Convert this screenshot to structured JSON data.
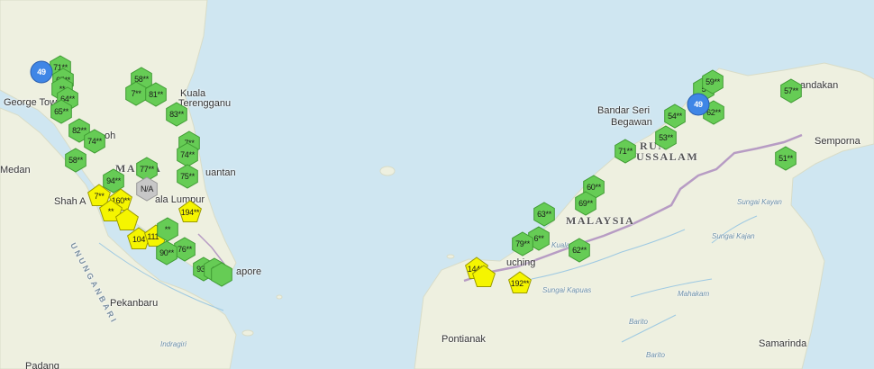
{
  "colors": {
    "sea": "#cfe6f1",
    "land": "#eef0e0",
    "good": "#66cc55",
    "moderate": "#f5f500",
    "blue": "#3f86e6",
    "na": "#c7c7c7",
    "border": "#b79cc4",
    "river": "#9ec9e2"
  },
  "labels": [
    {
      "id": "kuala-terengganu-1",
      "text": "Kuala",
      "kind": "city"
    },
    {
      "id": "kuala-terengganu-2",
      "text": "Terengganu",
      "kind": "city"
    },
    {
      "id": "george-town",
      "text": "George Town",
      "kind": "city"
    },
    {
      "id": "ipoh",
      "text": "oh",
      "kind": "city"
    },
    {
      "id": "medan",
      "text": "Medan",
      "kind": "city"
    },
    {
      "id": "malaysia-west",
      "text": "MA      SIA",
      "kind": "country"
    },
    {
      "id": "kuantan",
      "text": "uantan",
      "kind": "city"
    },
    {
      "id": "shah-alam",
      "text": "Shah A",
      "kind": "city"
    },
    {
      "id": "kuala-lumpur",
      "text": "ala Lumpur",
      "kind": "city"
    },
    {
      "id": "singapore",
      "text": "apore",
      "kind": "city"
    },
    {
      "id": "pekanbaru",
      "text": "Pekanbaru",
      "kind": "city"
    },
    {
      "id": "indragiri",
      "text": "Indragiri",
      "kind": "river"
    },
    {
      "id": "padang",
      "text": "Padang",
      "kind": "city"
    },
    {
      "id": "bukit-barisan",
      "text": "UNUNGANBARI",
      "kind": "sea"
    },
    {
      "id": "bandar-seri-1",
      "text": "Bandar Seri",
      "kind": "city"
    },
    {
      "id": "bandar-seri-2",
      "text": "Begawan",
      "kind": "city"
    },
    {
      "id": "brunei-1",
      "text": "RUN",
      "kind": "country"
    },
    {
      "id": "brunei-2",
      "text": "USSALAM",
      "kind": "country"
    },
    {
      "id": "sandakan",
      "text": "andakan",
      "kind": "city"
    },
    {
      "id": "semporna",
      "text": "Semporna",
      "kind": "city"
    },
    {
      "id": "malaysia-east",
      "text": "MALAYSIA",
      "kind": "country"
    },
    {
      "id": "kuching",
      "text": "uching",
      "kind": "city"
    },
    {
      "id": "kapuas",
      "text": "Sungai Kapuas",
      "kind": "river"
    },
    {
      "id": "mahakam",
      "text": "Mahakam",
      "kind": "river"
    },
    {
      "id": "barito1",
      "text": "Barito",
      "kind": "river"
    },
    {
      "id": "barito2",
      "text": "Barito",
      "kind": "river"
    },
    {
      "id": "kayan",
      "text": "Sungai Kayan",
      "kind": "river"
    },
    {
      "id": "kajan",
      "text": "Sungai Kajan",
      "kind": "river"
    },
    {
      "id": "kuala-krai",
      "text": "Kuala Kra",
      "kind": "river"
    },
    {
      "id": "pontianak",
      "text": "Pontianak",
      "kind": "city"
    },
    {
      "id": "samarinda",
      "text": "Samarinda",
      "kind": "city"
    }
  ],
  "markers": [
    {
      "value": "71**",
      "category": "good",
      "shape": "hexagon"
    },
    {
      "value": "65**",
      "category": "good",
      "shape": "hexagon"
    },
    {
      "value": "**",
      "category": "good",
      "shape": "hexagon"
    },
    {
      "value": "64**",
      "category": "good",
      "shape": "hexagon"
    },
    {
      "value": "65**",
      "category": "good",
      "shape": "hexagon"
    },
    {
      "value": "82**",
      "category": "good",
      "shape": "hexagon"
    },
    {
      "value": "74**",
      "category": "good",
      "shape": "hexagon"
    },
    {
      "value": "58**",
      "category": "good",
      "shape": "hexagon"
    },
    {
      "value": "58**",
      "category": "good",
      "shape": "hexagon"
    },
    {
      "value": "7**",
      "category": "good",
      "shape": "hexagon"
    },
    {
      "value": "81**",
      "category": "good",
      "shape": "hexagon"
    },
    {
      "value": "83**",
      "category": "good",
      "shape": "hexagon"
    },
    {
      "value": "7**",
      "category": "good",
      "shape": "hexagon"
    },
    {
      "value": "74**",
      "category": "good",
      "shape": "hexagon"
    },
    {
      "value": "75**",
      "category": "good",
      "shape": "hexagon"
    },
    {
      "value": "77**",
      "category": "good",
      "shape": "hexagon"
    },
    {
      "value": "N/A",
      "category": "na",
      "shape": "hexagon"
    },
    {
      "value": "94**",
      "category": "good",
      "shape": "hexagon"
    },
    {
      "value": "7**",
      "category": "moderate",
      "shape": "pentagon"
    },
    {
      "value": "160**",
      "category": "moderate",
      "shape": "pentagon"
    },
    {
      "value": "**",
      "category": "moderate",
      "shape": "pentagon"
    },
    {
      "value": "",
      "category": "moderate",
      "shape": "pentagon"
    },
    {
      "value": "104",
      "category": "moderate",
      "shape": "pentagon"
    },
    {
      "value": "111**",
      "category": "moderate",
      "shape": "pentagon"
    },
    {
      "value": "194**",
      "category": "moderate",
      "shape": "pentagon"
    },
    {
      "value": "**",
      "category": "good",
      "shape": "hexagon"
    },
    {
      "value": "76**",
      "category": "good",
      "shape": "hexagon"
    },
    {
      "value": "90**",
      "category": "good",
      "shape": "hexagon"
    },
    {
      "value": "93**",
      "category": "good",
      "shape": "hexagon"
    },
    {
      "value": "**",
      "category": "good",
      "shape": "hexagon"
    },
    {
      "value": "",
      "category": "good",
      "shape": "hexagon"
    },
    {
      "value": "63**",
      "category": "good",
      "shape": "hexagon"
    },
    {
      "value": "6**",
      "category": "good",
      "shape": "hexagon"
    },
    {
      "value": "79**",
      "category": "good",
      "shape": "hexagon"
    },
    {
      "value": "62**",
      "category": "good",
      "shape": "hexagon"
    },
    {
      "value": "60**",
      "category": "good",
      "shape": "hexagon"
    },
    {
      "value": "69**",
      "category": "good",
      "shape": "hexagon"
    },
    {
      "value": "144**",
      "category": "moderate",
      "shape": "pentagon"
    },
    {
      "value": "",
      "category": "moderate",
      "shape": "pentagon"
    },
    {
      "value": "192**",
      "category": "moderate",
      "shape": "pentagon"
    },
    {
      "value": "71**",
      "category": "good",
      "shape": "hexagon"
    },
    {
      "value": "53**",
      "category": "good",
      "shape": "hexagon"
    },
    {
      "value": "54**",
      "category": "good",
      "shape": "hexagon"
    },
    {
      "value": "5",
      "category": "good",
      "shape": "hexagon"
    },
    {
      "value": "62**",
      "category": "good",
      "shape": "hexagon"
    },
    {
      "value": "59**",
      "category": "good",
      "shape": "hexagon"
    },
    {
      "value": "57**",
      "category": "good",
      "shape": "hexagon"
    },
    {
      "value": "51**",
      "category": "good",
      "shape": "hexagon"
    },
    {
      "value": "49",
      "category": "blue",
      "shape": "circle"
    },
    {
      "value": "49",
      "category": "blue",
      "shape": "circle"
    }
  ]
}
